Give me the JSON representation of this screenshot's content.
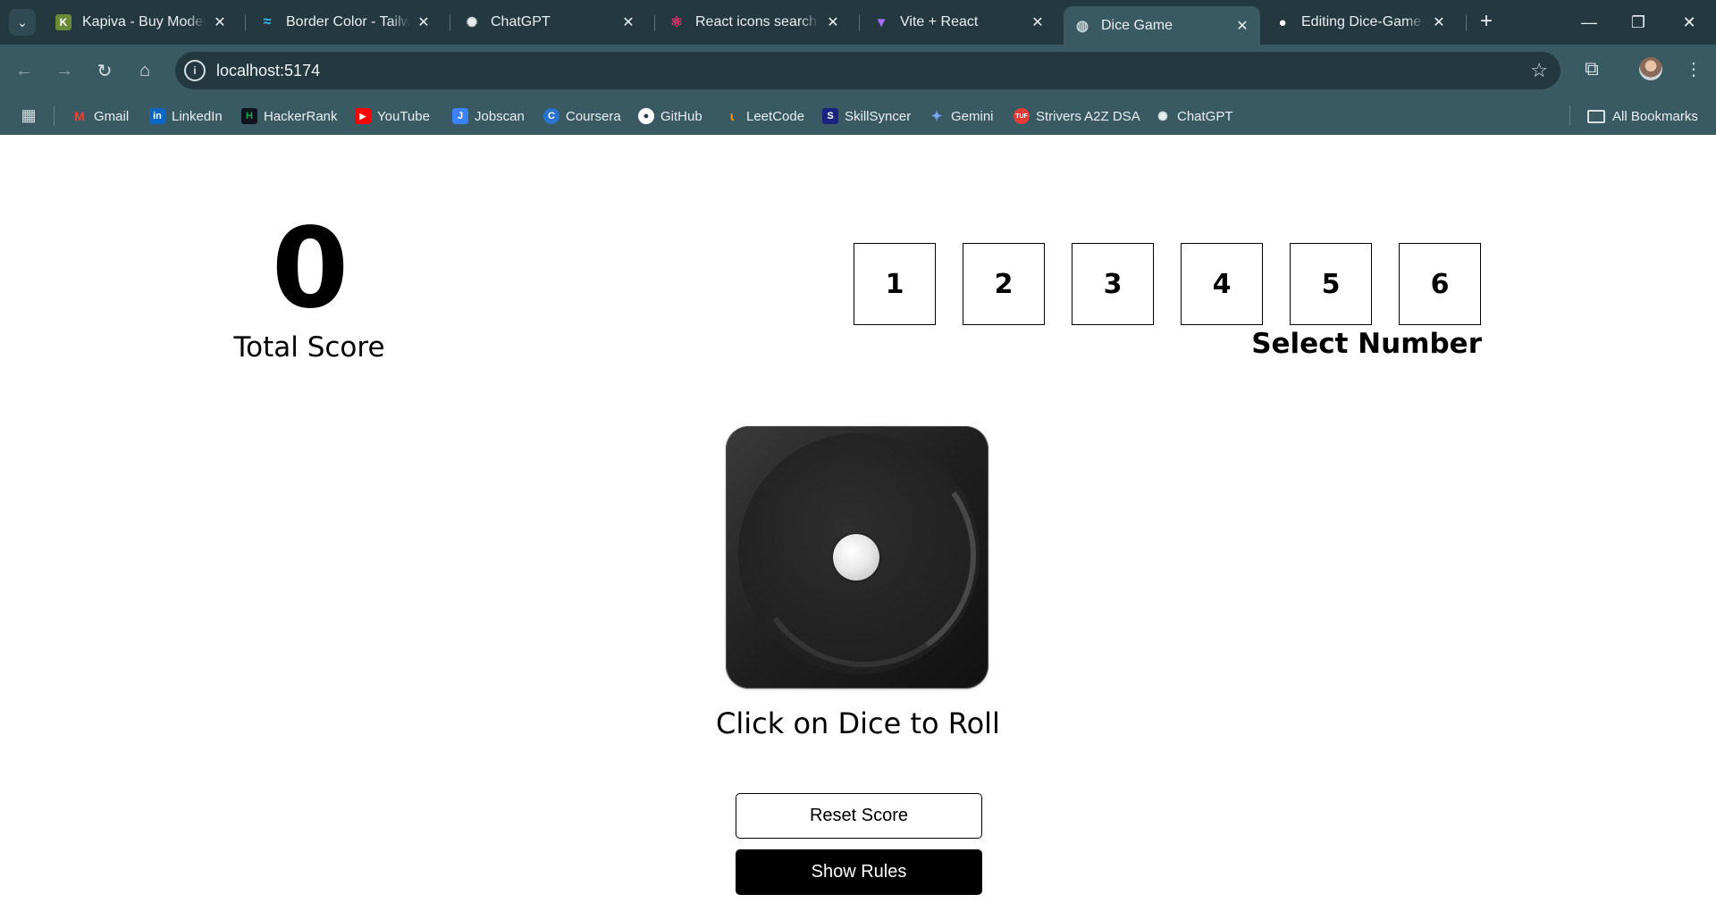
{
  "browser": {
    "tabs": [
      {
        "title": "Kapiva - Buy Modern",
        "icon": "kapiva-icon",
        "color": "#6a8a3a",
        "active": false
      },
      {
        "title": "Border Color - Tailwi",
        "icon": "tailwind-icon",
        "color": "#38bdf8",
        "active": false
      },
      {
        "title": "ChatGPT",
        "icon": "chatgpt-icon",
        "color": "#e8eef0",
        "active": false
      },
      {
        "title": "React icons search re",
        "icon": "react-icon",
        "color": "#e0336b",
        "active": false
      },
      {
        "title": "Vite + React",
        "icon": "vite-icon",
        "color": "#a970ff",
        "active": false
      },
      {
        "title": "Dice Game",
        "icon": "globe-icon",
        "color": "#c9d4d7",
        "active": true
      },
      {
        "title": "Editing Dice-Game-W",
        "icon": "github-icon",
        "color": "#ffffff",
        "active": false
      }
    ],
    "new_tab_glyph": "+",
    "window_controls": {
      "minimize": "—",
      "restore": "❐",
      "close": "✕"
    },
    "address": "localhost:5174",
    "bookmarks": [
      {
        "label": "Gmail",
        "icon": "gmail-icon",
        "color": "#ea4335"
      },
      {
        "label": "LinkedIn",
        "icon": "linkedin-icon",
        "color": "#0a66c2"
      },
      {
        "label": "HackerRank",
        "icon": "hackerrank-icon",
        "color": "#1ba94c"
      },
      {
        "label": "YouTube",
        "icon": "youtube-icon",
        "color": "#ff0000"
      },
      {
        "label": "Jobscan",
        "icon": "jobscan-icon",
        "color": "#3b82f6"
      },
      {
        "label": "Coursera",
        "icon": "coursera-icon",
        "color": "#2a73cc"
      },
      {
        "label": "GitHub",
        "icon": "github-icon",
        "color": "#ffffff"
      },
      {
        "label": "LeetCode",
        "icon": "leetcode-icon",
        "color": "#f89f1b"
      },
      {
        "label": "SkillSyncer",
        "icon": "skillsyncer-icon",
        "color": "#1a237e"
      },
      {
        "label": "Gemini",
        "icon": "gemini-icon",
        "color": "#7aa7ff"
      },
      {
        "label": "Strivers A2Z DSA",
        "icon": "striver-icon",
        "color": "#e53935"
      },
      {
        "label": "ChatGPT",
        "icon": "chatgpt-icon",
        "color": "#e8eef0"
      }
    ],
    "all_bookmarks": "All Bookmarks"
  },
  "game": {
    "score_value": "0",
    "score_label": "Total Score",
    "numbers": [
      "1",
      "2",
      "3",
      "4",
      "5",
      "6"
    ],
    "select_label": "Select Number",
    "dice_face": 1,
    "hint": "Click on Dice to Roll",
    "reset_label": "Reset Score",
    "rules_label": "Show Rules"
  }
}
